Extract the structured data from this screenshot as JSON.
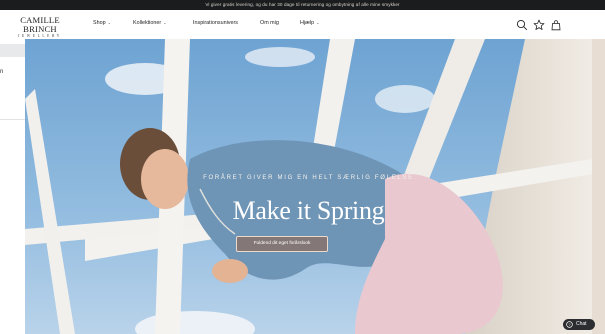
{
  "announcement": "Vi giver gratis levering, og du har 30 dage til returnering og ombytning af alle mine smykker",
  "header": {
    "logo_brand": "CAMILLE BRINCH",
    "logo_sub": "JEWELLERY",
    "nav": [
      {
        "label": "Shop",
        "has_dropdown": true
      },
      {
        "label": "Kollektioner",
        "has_dropdown": true
      },
      {
        "label": "Inspirationsunivers",
        "has_dropdown": false
      },
      {
        "label": "Om mig",
        "has_dropdown": false
      },
      {
        "label": "Hjælp",
        "has_dropdown": true
      }
    ],
    "icons": [
      "search-icon",
      "star-icon",
      "bag-icon"
    ],
    "chevron_glyph": "⌄"
  },
  "hero": {
    "eyebrow": "FORÅRET GIVER MIG EN HELT SÆRLIG FØLELSE",
    "headline": "Make it Spring",
    "cta_label": "Fuldend dit eget forårslook"
  },
  "side_panel": {
    "label": "n"
  },
  "chat": {
    "label": "Chat"
  },
  "colors": {
    "announcement_bg": "#1b1c1e",
    "sky": "#8fb9dc",
    "sweater": "#6f95b6",
    "cta_bg": "#a0664a"
  }
}
